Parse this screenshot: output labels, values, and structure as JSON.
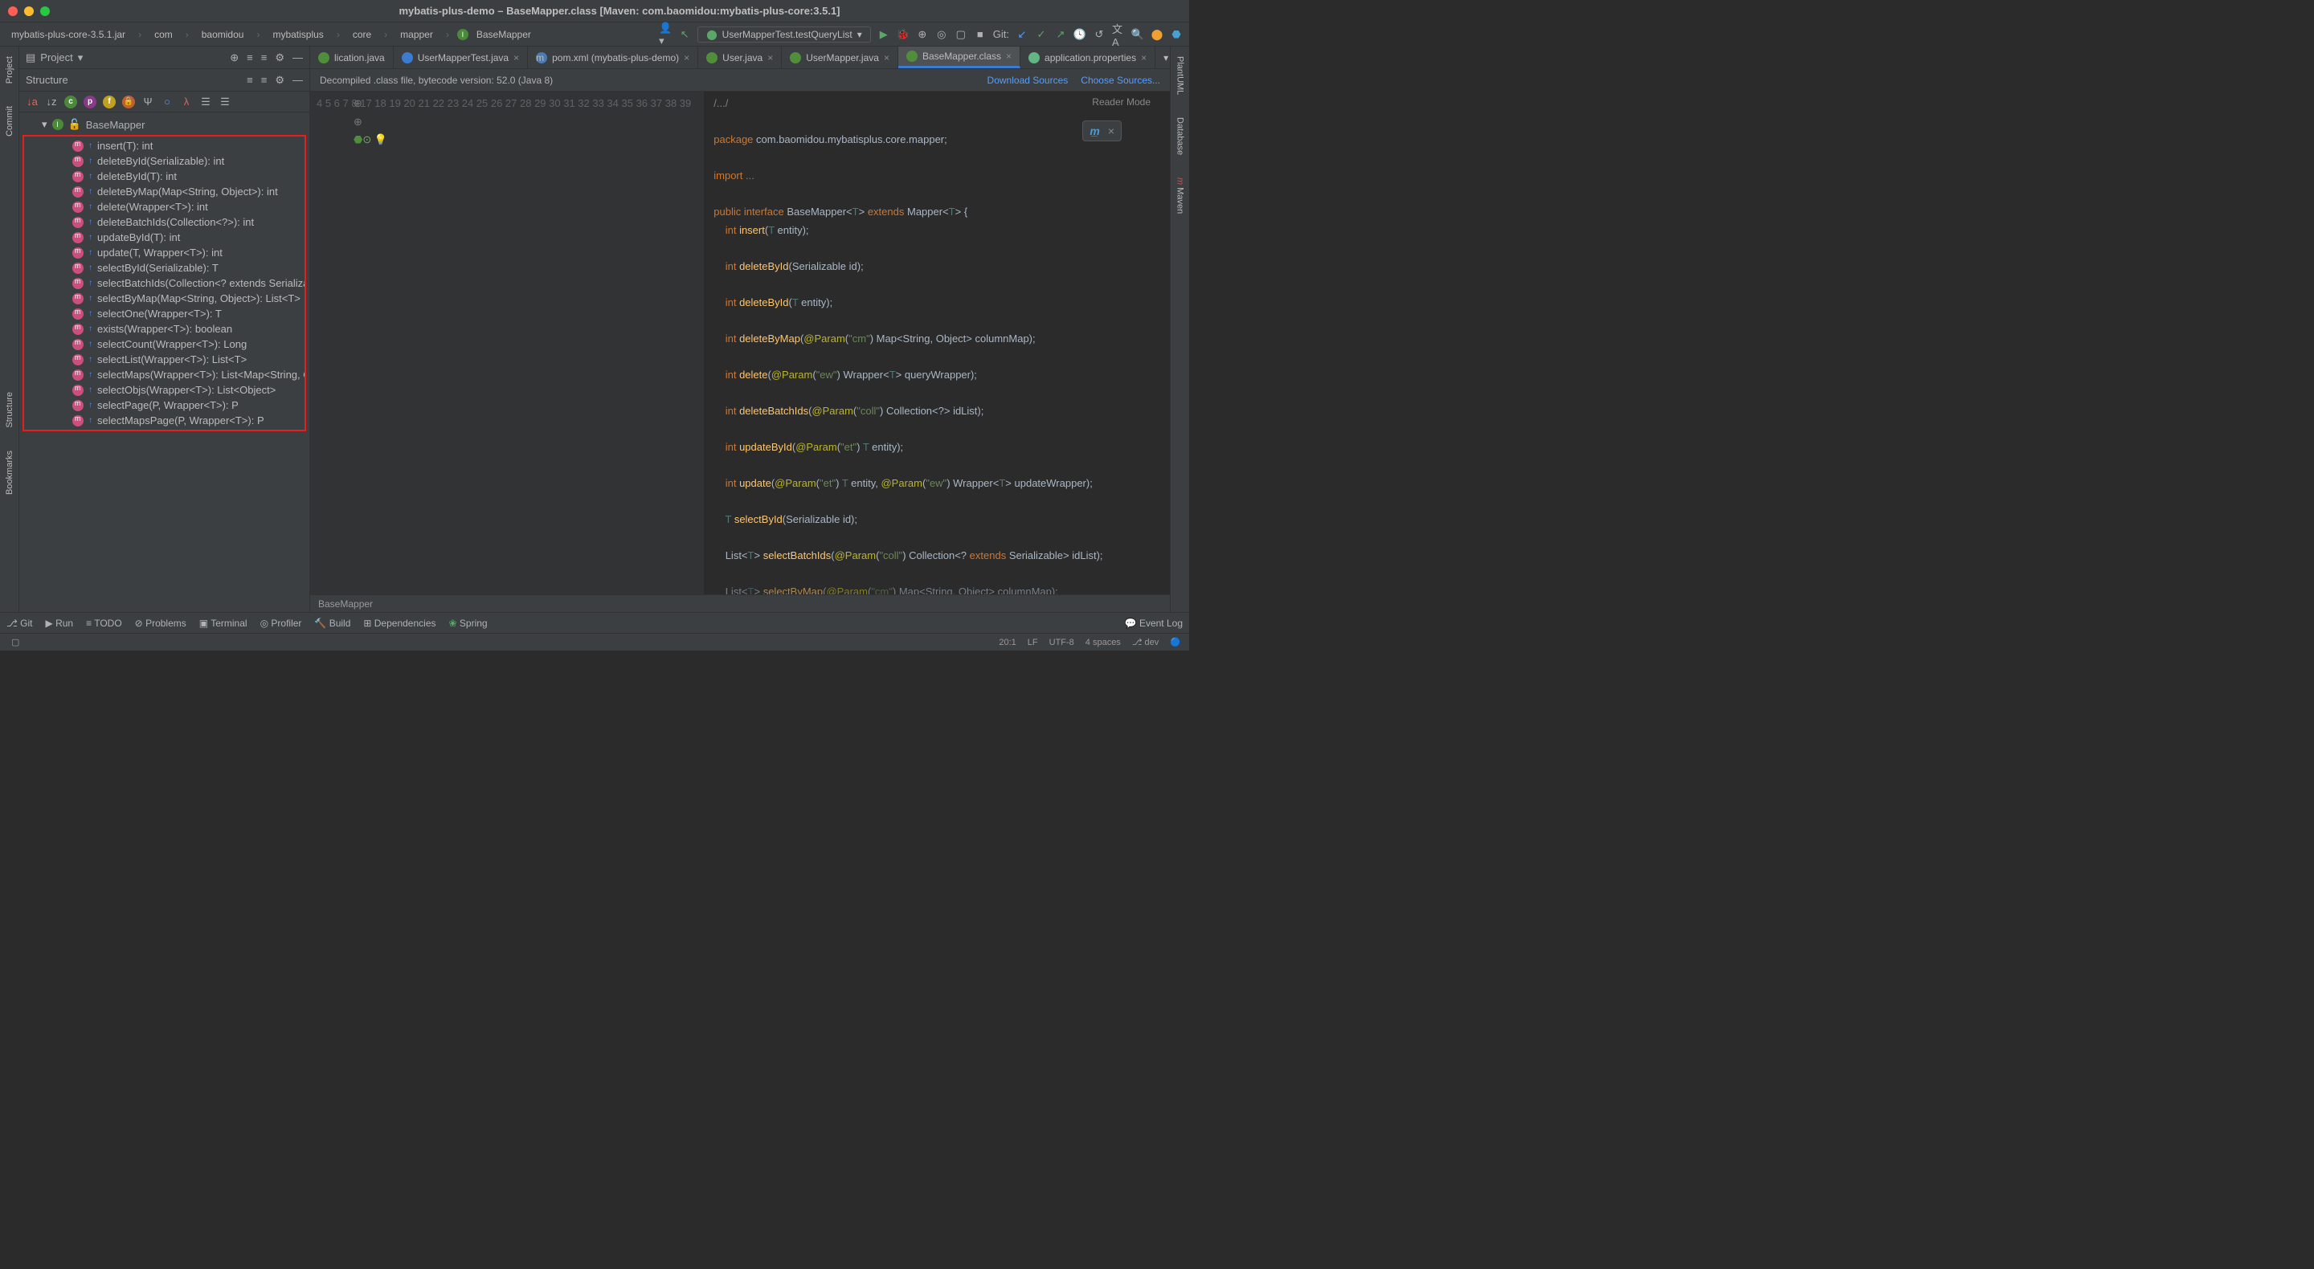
{
  "window_title": "mybatis-plus-demo – BaseMapper.class [Maven: com.baomidou:mybatis-plus-core:3.5.1]",
  "breadcrumbs": [
    "mybatis-plus-core-3.5.1.jar",
    "com",
    "baomidou",
    "mybatisplus",
    "core",
    "mapper",
    "BaseMapper"
  ],
  "run_config": "UserMapperTest.testQueryList",
  "git_label": "Git:",
  "project_panel": {
    "title": "Project"
  },
  "structure_panel": {
    "title": "Structure"
  },
  "structure_root": "BaseMapper",
  "methods": [
    "insert(T): int",
    "deleteById(Serializable): int",
    "deleteById(T): int",
    "deleteByMap(Map<String, Object>): int",
    "delete(Wrapper<T>): int",
    "deleteBatchIds(Collection<?>): int",
    "updateById(T): int",
    "update(T, Wrapper<T>): int",
    "selectById(Serializable): T",
    "selectBatchIds(Collection<? extends Serializable>",
    "selectByMap(Map<String, Object>): List<T>",
    "selectOne(Wrapper<T>): T",
    "exists(Wrapper<T>): boolean",
    "selectCount(Wrapper<T>): Long",
    "selectList(Wrapper<T>): List<T>",
    "selectMaps(Wrapper<T>): List<Map<String, Object>>",
    "selectObjs(Wrapper<T>): List<Object>",
    "selectPage(P, Wrapper<T>): P",
    "selectMapsPage(P, Wrapper<T>): P"
  ],
  "editor_tabs": [
    {
      "label": "lication.java",
      "icon": "cl"
    },
    {
      "label": "UserMapperTest.java",
      "icon": "cy"
    },
    {
      "label": "pom.xml (mybatis-plus-demo)",
      "icon": "mg"
    },
    {
      "label": "User.java",
      "icon": "cl"
    },
    {
      "label": "UserMapper.java",
      "icon": "int"
    },
    {
      "label": "BaseMapper.class",
      "icon": "int",
      "active": true
    },
    {
      "label": "application.properties",
      "icon": "cfg"
    }
  ],
  "banner_text": "Decompiled .class file, bytecode version: 52.0 (Java 8)",
  "banner_link1": "Download Sources",
  "banner_link2": "Choose Sources...",
  "reader_mode": "Reader Mode",
  "line_numbers": [
    4,
    5,
    6,
    7,
    8,
    17,
    18,
    19,
    20,
    21,
    22,
    23,
    24,
    25,
    26,
    27,
    28,
    29,
    30,
    31,
    32,
    33,
    34,
    35,
    36,
    37,
    38,
    39
  ],
  "bottom_crumb": "BaseMapper",
  "left_rail": [
    "Project",
    "Commit",
    "Structure",
    "Bookmarks"
  ],
  "right_rail": [
    "PlantUML",
    "Database",
    "Maven"
  ],
  "footer_tools": {
    "git": "Git",
    "run": "Run",
    "todo": "TODO",
    "problems": "Problems",
    "terminal": "Terminal",
    "profiler": "Profiler",
    "build": "Build",
    "dependencies": "Dependencies",
    "spring": "Spring",
    "eventlog": "Event Log"
  },
  "status": {
    "pos": "20:1",
    "sep": "LF",
    "enc": "UTF-8",
    "indent": "4 spaces",
    "branch": "dev"
  }
}
